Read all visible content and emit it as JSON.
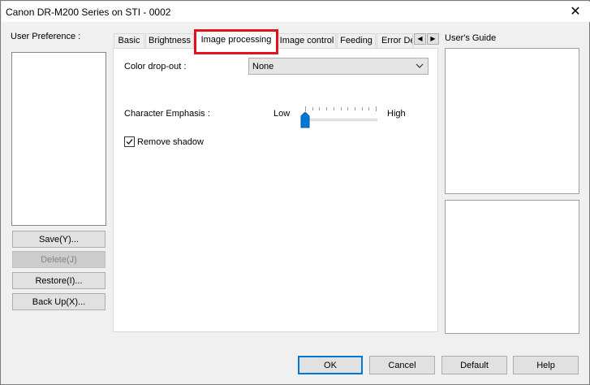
{
  "window": {
    "title": "Canon DR-M200 Series on STI - 0002"
  },
  "left_panel": {
    "label": "User Preference :",
    "buttons": {
      "save": "Save(Y)...",
      "delete": "Delete(J)",
      "restore": "Restore(I)...",
      "backup": "Back Up(X)..."
    }
  },
  "tabs": [
    {
      "label": "Basic"
    },
    {
      "label": "Brightness"
    },
    {
      "label": "Image processing"
    },
    {
      "label": "Image control"
    },
    {
      "label": "Feeding"
    },
    {
      "label": "Error De"
    }
  ],
  "active_tab": "Image processing",
  "settings": {
    "color_dropout": {
      "label": "Color drop-out :",
      "value": "None"
    },
    "character_emphasis": {
      "label": "Character Emphasis :",
      "low_label": "Low",
      "high_label": "High",
      "level": 0
    },
    "remove_shadow": {
      "label": "Remove shadow",
      "checked": true
    }
  },
  "right_panel": {
    "label": "User's Guide"
  },
  "footer": {
    "ok": "OK",
    "cancel": "Cancel",
    "default": "Default",
    "help": "Help"
  },
  "colors": {
    "highlight": "#e3101f",
    "focus": "#0078d7"
  }
}
